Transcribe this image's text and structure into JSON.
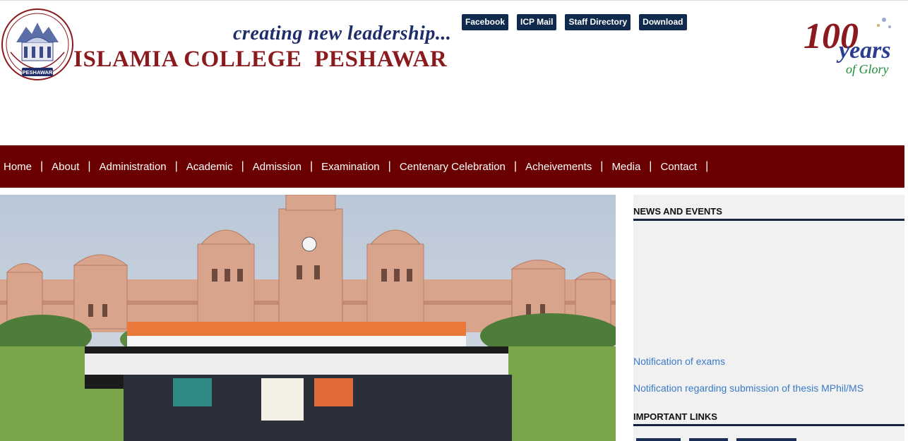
{
  "header": {
    "tagline": "creating new leadership...",
    "college_name": "ISLAMIA COLLEGE  PESHAWAR",
    "logo_text": "PESHAWAR",
    "top_links": [
      "Facebook",
      "ICP Mail",
      "Staff Directory",
      "Download"
    ],
    "anniversary": {
      "number": "100",
      "word": "years",
      "tag": "of Glory"
    }
  },
  "nav": {
    "items": [
      "Home",
      "About",
      "Administration",
      "Academic",
      "Admission",
      "Examination",
      "Centenary Celebration",
      "Acheivements",
      "Media",
      "Contact"
    ],
    "separator": "|"
  },
  "sidebar": {
    "news_heading": "NEWS AND EVENTS",
    "news": [
      "Notification of exams",
      "Notification regarding submission of thesis MPhil/MS"
    ],
    "links_heading": "IMPORTANT LINKS"
  },
  "colors": {
    "nav_bg": "#6a0000",
    "brand_red": "#8a1a1e",
    "tagline_blue": "#1f2d6b",
    "link_blue": "#3a7bc8",
    "top_link_bg": "#0f2a4d"
  }
}
